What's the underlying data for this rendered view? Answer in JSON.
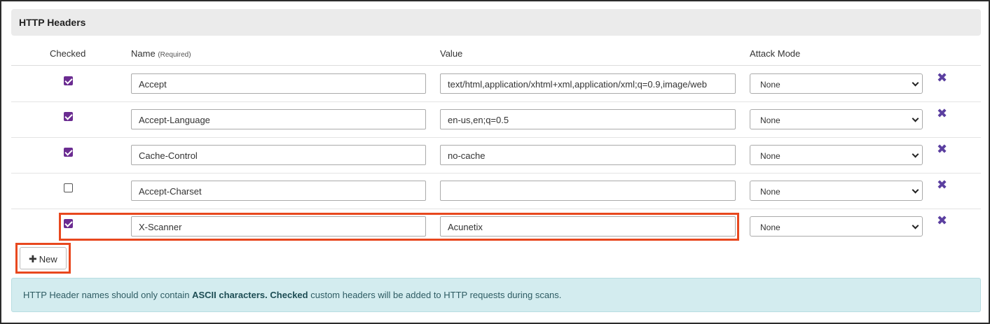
{
  "panel": {
    "title": "HTTP Headers"
  },
  "columns": {
    "checked": "Checked",
    "name": "Name",
    "name_hint": "(Required)",
    "value": "Value",
    "attack_mode": "Attack Mode"
  },
  "rows": [
    {
      "checked": true,
      "name": "Accept",
      "value": "text/html,application/xhtml+xml,application/xml;q=0.9,image/web",
      "attack_mode": "None"
    },
    {
      "checked": true,
      "name": "Accept-Language",
      "value": "en-us,en;q=0.5",
      "attack_mode": "None"
    },
    {
      "checked": true,
      "name": "Cache-Control",
      "value": "no-cache",
      "attack_mode": "None"
    },
    {
      "checked": false,
      "name": "Accept-Charset",
      "value": "",
      "attack_mode": "None"
    },
    {
      "checked": true,
      "name": "X-Scanner",
      "value": "Acunetix",
      "attack_mode": "None"
    }
  ],
  "new_button": {
    "label": "New",
    "icon": "plus-icon"
  },
  "alert": {
    "part1": "HTTP Header names should only contain ",
    "bold1": "ASCII characters.",
    "part2": " ",
    "bold2": "Checked",
    "part3": " custom headers will be added to HTTP requests during scans."
  },
  "colors": {
    "accent": "#6b2c91",
    "highlight": "#e8481e",
    "alert_bg": "#d3ecef",
    "delete_icon": "#5b3fa0"
  }
}
